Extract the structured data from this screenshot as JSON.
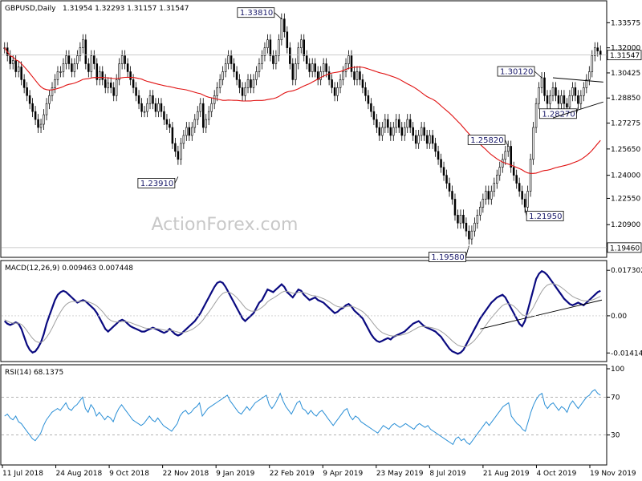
{
  "header": {
    "symbol": "GBPUSD,Daily",
    "ohlc": "1.31954 1.32293 1.31157 1.31547",
    "macd": "MACD(12,26,9) 0.009463 0.007448",
    "rsi": "RSI(14) 68.1375"
  },
  "watermark": "ActionForex.com",
  "colors": {
    "background": "#ffffff",
    "candle": "#000000",
    "ma": "#e01010",
    "macd": "#0a0a80",
    "signal": "#a0a0a0",
    "rsi": "#2a8fd6",
    "annotation": "#1a1a6a"
  },
  "chart_data": [
    {
      "type": "candlestick",
      "title": "GBPUSD,Daily",
      "ylim": [
        1.19,
        1.348
      ],
      "y_ticks": [
        "1.33575",
        "1.32000",
        "1.30425",
        "1.28850",
        "1.27275",
        "1.25650",
        "1.24000",
        "1.22550",
        "1.20900"
      ],
      "y_tick_values": [
        1.33575,
        1.32,
        1.30425,
        1.2885,
        1.27275,
        1.2565,
        1.24,
        1.2255,
        1.209
      ],
      "price_tags": [
        {
          "label": "1.31547",
          "value": 1.31547
        },
        {
          "label": "1.19460",
          "value": 1.1946
        }
      ],
      "x_labels": [
        "11 Jul 2018",
        "24 Aug 2018",
        "9 Oct 2018",
        "22 Nov 2018",
        "9 Jan 2019",
        "22 Feb 2019",
        "9 Apr 2019",
        "23 May 2019",
        "8 Jul 2019",
        "21 Aug 2019",
        "4 Oct 2019",
        "19 Nov 2019"
      ],
      "closes": [
        1.32,
        1.315,
        1.31,
        1.312,
        1.305,
        1.308,
        1.3,
        1.295,
        1.29,
        1.285,
        1.28,
        1.275,
        1.27,
        1.272,
        1.278,
        1.285,
        1.29,
        1.295,
        1.3,
        1.305,
        1.305,
        1.31,
        1.315,
        1.31,
        1.305,
        1.31,
        1.315,
        1.32,
        1.325,
        1.31,
        1.305,
        1.315,
        1.31,
        1.3,
        1.305,
        1.3,
        1.295,
        1.298,
        1.295,
        1.29,
        1.3,
        1.31,
        1.315,
        1.31,
        1.305,
        1.3,
        1.295,
        1.29,
        1.285,
        1.28,
        1.28,
        1.285,
        1.29,
        1.285,
        1.28,
        1.285,
        1.28,
        1.275,
        1.272,
        1.27,
        1.26,
        1.255,
        1.25,
        1.26,
        1.265,
        1.27,
        1.265,
        1.27,
        1.275,
        1.28,
        1.285,
        1.27,
        1.275,
        1.28,
        1.285,
        1.29,
        1.295,
        1.3,
        1.305,
        1.31,
        1.315,
        1.31,
        1.305,
        1.3,
        1.295,
        1.29,
        1.295,
        1.3,
        1.295,
        1.3,
        1.305,
        1.31,
        1.315,
        1.32,
        1.325,
        1.315,
        1.31,
        1.315,
        1.325,
        1.3381,
        1.33,
        1.32,
        1.31,
        1.3,
        1.31,
        1.32,
        1.325,
        1.315,
        1.31,
        1.305,
        1.31,
        1.305,
        1.3,
        1.305,
        1.31,
        1.305,
        1.3,
        1.295,
        1.29,
        1.295,
        1.3,
        1.305,
        1.31,
        1.315,
        1.305,
        1.3,
        1.305,
        1.3,
        1.295,
        1.29,
        1.285,
        1.28,
        1.275,
        1.27,
        1.265,
        1.27,
        1.275,
        1.27,
        1.265,
        1.27,
        1.275,
        1.27,
        1.265,
        1.27,
        1.275,
        1.27,
        1.265,
        1.26,
        1.265,
        1.27,
        1.265,
        1.26,
        1.265,
        1.26,
        1.255,
        1.25,
        1.245,
        1.24,
        1.235,
        1.23,
        1.225,
        1.215,
        1.21,
        1.215,
        1.21,
        1.205,
        1.2,
        1.205,
        1.21,
        1.215,
        1.22,
        1.225,
        1.23,
        1.225,
        1.23,
        1.235,
        1.24,
        1.245,
        1.25,
        1.255,
        1.2582,
        1.245,
        1.24,
        1.235,
        1.23,
        1.225,
        1.22,
        1.23,
        1.25,
        1.27,
        1.285,
        1.295,
        1.3012,
        1.29,
        1.285,
        1.29,
        1.295,
        1.29,
        1.285,
        1.29,
        1.285,
        1.2827,
        1.29,
        1.295,
        1.29,
        1.285,
        1.29,
        1.295,
        1.3,
        1.305,
        1.315,
        1.32,
        1.318,
        1.3155
      ],
      "ma_period": 50,
      "annotations": [
        {
          "label": "1.33810",
          "value": 1.3381
        },
        {
          "label": "1.23910",
          "value": 1.2391
        },
        {
          "label": "1.30120",
          "value": 1.3012
        },
        {
          "label": "1.28270",
          "value": 1.2827
        },
        {
          "label": "1.25820",
          "value": 1.2582
        },
        {
          "label": "1.21950",
          "value": 1.2195
        },
        {
          "label": "1.19580",
          "value": 1.1958
        }
      ]
    },
    {
      "type": "line",
      "title": "MACD(12,26,9) 0.009463 0.007448",
      "ylim": [
        -0.0165,
        0.0195
      ],
      "y_ticks": [
        "0.017302",
        "0.00",
        "-0.014148"
      ],
      "y_tick_values": [
        0.017302,
        0,
        -0.014148
      ],
      "series": [
        {
          "name": "MACD",
          "values": [
            -0.002,
            -0.003,
            -0.0035,
            -0.003,
            -0.0025,
            -0.003,
            -0.005,
            -0.008,
            -0.011,
            -0.013,
            -0.014,
            -0.0135,
            -0.012,
            -0.01,
            -0.007,
            -0.003,
            0.0,
            0.003,
            0.006,
            0.008,
            0.009,
            0.0095,
            0.009,
            0.008,
            0.007,
            0.006,
            0.005,
            0.0055,
            0.006,
            0.0055,
            0.0045,
            0.0035,
            0.0025,
            0.001,
            -0.001,
            -0.003,
            -0.005,
            -0.006,
            -0.005,
            -0.004,
            -0.003,
            -0.002,
            -0.0015,
            -0.002,
            -0.003,
            -0.004,
            -0.0045,
            -0.005,
            -0.0055,
            -0.006,
            -0.006,
            -0.0055,
            -0.005,
            -0.0045,
            -0.005,
            -0.0055,
            -0.006,
            -0.0065,
            -0.006,
            -0.005,
            -0.006,
            -0.007,
            -0.0075,
            -0.007,
            -0.006,
            -0.005,
            -0.004,
            -0.003,
            -0.002,
            -0.0005,
            0.001,
            0.003,
            0.005,
            0.007,
            0.009,
            0.011,
            0.0125,
            0.013,
            0.0125,
            0.011,
            0.009,
            0.007,
            0.005,
            0.003,
            0.001,
            -0.001,
            -0.002,
            -0.001,
            0.0,
            0.001,
            0.003,
            0.005,
            0.006,
            0.008,
            0.01,
            0.0095,
            0.009,
            0.01,
            0.011,
            0.012,
            0.011,
            0.009,
            0.008,
            0.007,
            0.0085,
            0.01,
            0.0095,
            0.008,
            0.007,
            0.006,
            0.0065,
            0.007,
            0.006,
            0.0055,
            0.005,
            0.004,
            0.003,
            0.002,
            0.001,
            0.0015,
            0.0025,
            0.003,
            0.004,
            0.0045,
            0.0035,
            0.002,
            0.001,
            0.0,
            -0.001,
            -0.003,
            -0.005,
            -0.007,
            -0.0085,
            -0.0095,
            -0.01,
            -0.0095,
            -0.009,
            -0.0085,
            -0.009,
            -0.008,
            -0.0075,
            -0.007,
            -0.0065,
            -0.006,
            -0.005,
            -0.004,
            -0.003,
            -0.0025,
            -0.002,
            -0.003,
            -0.004,
            -0.0045,
            -0.005,
            -0.0055,
            -0.006,
            -0.007,
            -0.008,
            -0.0095,
            -0.011,
            -0.0125,
            -0.0135,
            -0.014,
            -0.0145,
            -0.014,
            -0.013,
            -0.011,
            -0.009,
            -0.007,
            -0.005,
            -0.003,
            -0.001,
            0.0005,
            0.002,
            0.0035,
            0.005,
            0.006,
            0.007,
            0.0075,
            0.008,
            0.007,
            0.005,
            0.003,
            0.001,
            -0.001,
            -0.003,
            -0.004,
            -0.002,
            0.002,
            0.006,
            0.01,
            0.014,
            0.016,
            0.017,
            0.0165,
            0.0155,
            0.014,
            0.0125,
            0.011,
            0.0095,
            0.008,
            0.0065,
            0.0055,
            0.0045,
            0.004,
            0.0045,
            0.005,
            0.0045,
            0.004,
            0.005,
            0.006,
            0.007,
            0.008,
            0.009,
            0.0095
          ]
        },
        {
          "name": "Signal",
          "values": [
            -0.0015,
            -0.002,
            -0.0025,
            -0.0028,
            -0.0028,
            -0.0028,
            -0.0033,
            -0.0043,
            -0.0057,
            -0.0072,
            -0.0086,
            -0.0096,
            -0.0101,
            -0.0101,
            -0.0095,
            -0.0082,
            -0.0066,
            -0.0047,
            -0.0025,
            -0.0004,
            0.0015,
            0.0031,
            0.0043,
            0.005,
            0.0054,
            0.0055,
            0.0054,
            0.0054,
            0.0055,
            0.0055,
            0.0053,
            0.0049,
            0.0044,
            0.0037,
            0.0027,
            0.0016,
            0.0003,
            -0.001,
            -0.0018,
            -0.0022,
            -0.0024,
            -0.0023,
            -0.0022,
            -0.0021,
            -0.0023,
            -0.0026,
            -0.003,
            -0.0034,
            -0.0038,
            -0.0042,
            -0.0046,
            -0.0048,
            -0.0048,
            -0.0048,
            -0.0048,
            -0.005,
            -0.0052,
            -0.0054,
            -0.0056,
            -0.0055,
            -0.0056,
            -0.0059,
            -0.0062,
            -0.0064,
            -0.0063,
            -0.0061,
            -0.0057,
            -0.0052,
            -0.0045,
            -0.0037,
            -0.0027,
            -0.0015,
            0.0,
            0.0014,
            0.0029,
            0.0045,
            0.0061,
            0.0075,
            0.0085,
            0.009,
            0.009,
            0.0086,
            0.0079,
            0.0069,
            0.0057,
            0.0044,
            0.0031,
            0.0023,
            0.0018,
            0.0017,
            0.0019,
            0.0025,
            0.0032,
            0.0041,
            0.0053,
            0.0061,
            0.0067,
            0.0074,
            0.0081,
            0.0089,
            0.0093,
            0.0093,
            0.009,
            0.0086,
            0.0086,
            0.0089,
            0.009,
            0.0088,
            0.0085,
            0.008,
            0.0077,
            0.0076,
            0.0073,
            0.0069,
            0.0065,
            0.006,
            0.0054,
            0.0047,
            0.004,
            0.0035,
            0.0033,
            0.0032,
            0.0034,
            0.0036,
            0.0036,
            0.0033,
            0.0028,
            0.0022,
            0.0016,
            0.0006,
            -0.0005,
            -0.0018,
            -0.0032,
            -0.0045,
            -0.0056,
            -0.0064,
            -0.0069,
            -0.0073,
            -0.0076,
            -0.0077,
            -0.0076,
            -0.0075,
            -0.0073,
            -0.007,
            -0.0066,
            -0.0061,
            -0.0055,
            -0.0049,
            -0.0043,
            -0.0041,
            -0.0041,
            -0.0042,
            -0.0044,
            -0.0046,
            -0.0049,
            -0.0053,
            -0.0059,
            -0.0066,
            -0.0075,
            -0.0085,
            -0.0095,
            -0.0104,
            -0.0112,
            -0.0116,
            -0.0118,
            -0.0117,
            -0.0111,
            -0.0103,
            -0.0093,
            -0.008,
            -0.0066,
            -0.0052,
            -0.0037,
            -0.0022,
            -0.0008,
            0.0005,
            0.0017,
            0.0029,
            0.0039,
            0.0045,
            0.0046,
            0.0043,
            0.0037,
            0.0027,
            0.0015,
            0.0004,
            0.0,
            0.0004,
            0.0015,
            0.0032,
            0.0053,
            0.0074,
            0.0093,
            0.0107,
            0.0117,
            0.0121,
            0.0122,
            0.0119,
            0.0115,
            0.0108,
            0.01,
            0.0091,
            0.0082,
            0.0074,
            0.0068,
            0.0064,
            0.006,
            0.0057,
            0.0057,
            0.0058,
            0.006,
            0.0064,
            0.0069,
            0.0074
          ]
        }
      ]
    },
    {
      "type": "line",
      "title": "RSI(14) 68.1375",
      "ylim": [
        0,
        100
      ],
      "y_ticks": [
        "100",
        "70",
        "30",
        "0"
      ],
      "y_tick_values": [
        100,
        70,
        30,
        0
      ],
      "series": [
        {
          "name": "RSI",
          "values": [
            50,
            52,
            48,
            46,
            50,
            44,
            42,
            38,
            34,
            30,
            26,
            24,
            28,
            32,
            40,
            46,
            50,
            54,
            56,
            58,
            56,
            60,
            64,
            58,
            56,
            60,
            62,
            66,
            70,
            58,
            54,
            62,
            58,
            50,
            54,
            50,
            46,
            50,
            48,
            44,
            52,
            58,
            62,
            58,
            54,
            50,
            46,
            44,
            42,
            40,
            42,
            46,
            50,
            46,
            44,
            48,
            44,
            40,
            38,
            36,
            34,
            38,
            42,
            50,
            54,
            56,
            52,
            54,
            58,
            60,
            64,
            50,
            54,
            58,
            60,
            62,
            64,
            66,
            68,
            70,
            72,
            66,
            62,
            58,
            54,
            52,
            56,
            60,
            56,
            60,
            64,
            66,
            68,
            70,
            72,
            62,
            58,
            62,
            68,
            74,
            66,
            60,
            56,
            52,
            58,
            64,
            66,
            58,
            56,
            52,
            56,
            52,
            50,
            54,
            56,
            52,
            48,
            44,
            40,
            44,
            48,
            52,
            56,
            58,
            50,
            46,
            50,
            48,
            44,
            42,
            40,
            38,
            36,
            34,
            32,
            36,
            40,
            38,
            36,
            40,
            42,
            40,
            38,
            40,
            42,
            40,
            38,
            36,
            40,
            42,
            40,
            38,
            40,
            36,
            34,
            32,
            30,
            28,
            26,
            24,
            22,
            20,
            26,
            28,
            24,
            26,
            22,
            20,
            24,
            28,
            32,
            36,
            40,
            44,
            40,
            44,
            48,
            52,
            56,
            60,
            62,
            64,
            50,
            46,
            42,
            40,
            36,
            34,
            44,
            54,
            62,
            68,
            72,
            74,
            62,
            58,
            62,
            64,
            60,
            56,
            60,
            58,
            54,
            62,
            66,
            62,
            58,
            62,
            66,
            70,
            72,
            76,
            78,
            74,
            72
          ]
        }
      ]
    }
  ]
}
